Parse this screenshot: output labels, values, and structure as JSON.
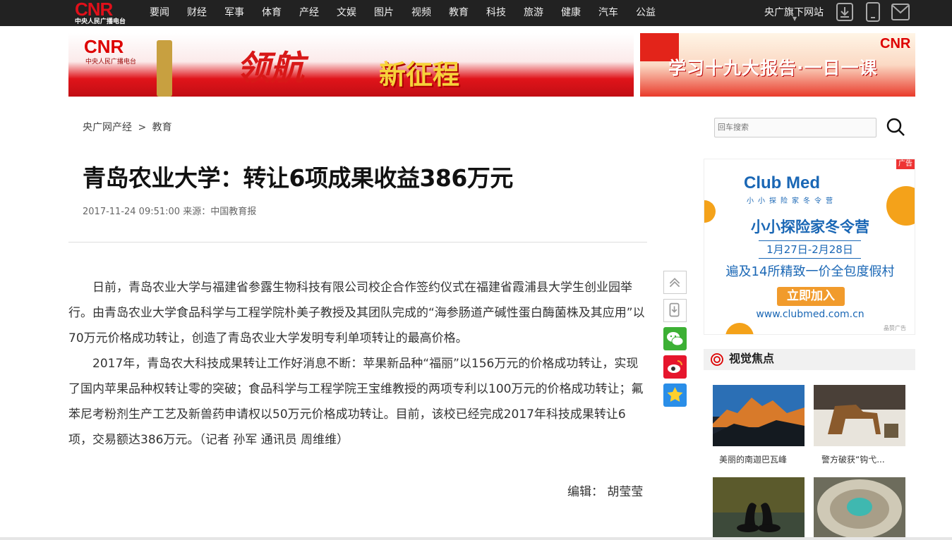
{
  "topnav": {
    "logo_text": "CNR",
    "logo_sub": "中央人民广播电台",
    "items": [
      "要闻",
      "财经",
      "军事",
      "体育",
      "产经",
      "文娱",
      "图片",
      "视频",
      "教育",
      "科技",
      "旅游",
      "健康",
      "汽车",
      "公益"
    ],
    "sites_label": "央广旗下网站",
    "icons": [
      "download-icon",
      "mobile-icon",
      "mail-icon"
    ]
  },
  "banners": {
    "left": {
      "logo": "CNR",
      "logo_sub": "中央人民广播电台",
      "title": "领航",
      "subtitle": "新征程"
    },
    "right": {
      "title": "学习十九大报告·一日一课",
      "logo": "CNR"
    }
  },
  "breadcrumb": {
    "parent": "央广网产经",
    "separator": ">",
    "current": "教育"
  },
  "search": {
    "placeholder": "回车搜索"
  },
  "article": {
    "title": "青岛农业大学：转让6项成果收益386万元",
    "datetime": "2017-11-24 09:51:00",
    "source": "来源：中国教育报",
    "paragraphs": [
      "日前，青岛农业大学与福建省参露生物科技有限公司校企合作签约仪式在福建省霞浦县大学生创业园举行。由青岛农业大学食品科学与工程学院朴美子教授及其团队完成的“海参肠道产碱性蛋白酶菌株及其应用”以70万元价格成功转让，创造了青岛农业大学发明专利单项转让的最高价格。",
      "2017年，青岛农大科技成果转让工作好消息不断：苹果新品种“福丽”以156万元的价格成功转让，实现了国内苹果品种权转让零的突破；食品科学与工程学院王宝维教授的两项专利以100万元的价格成功转让；氟苯尼考粉剂生产工艺及新兽药申请权以50万元价格成功转让。目前，该校已经完成2017年科技成果转让6项，交易额达386万元。（记者 孙军 通讯员 周维维）"
    ],
    "editor": "编辑： 胡莹莹"
  },
  "share": [
    "back-to-top-icon",
    "download-icon",
    "wechat-icon",
    "weibo-icon",
    "qzone-icon"
  ],
  "ad": {
    "tag": "广告",
    "brand": "Club Med",
    "brand_sub": "小小探险家冬令营",
    "headline": "小小探险家冬令营",
    "dates": "1月27日-2月28日",
    "offer": "遍及14所精致一价全包度假村",
    "cta": "立即加入",
    "url": "www.clubmed.com.cn",
    "footer": "晶赞广告"
  },
  "focus": {
    "heading": "视觉焦点",
    "items": [
      {
        "caption": "美丽的南迦巴瓦峰"
      },
      {
        "caption": "警方破获“钩弋..."
      },
      {
        "caption": ""
      },
      {
        "caption": ""
      }
    ]
  },
  "colors": {
    "nav_bg": "#222222",
    "accent_red": "#e0101a",
    "ad_blue": "#1a67b5",
    "ad_orange": "#f19b2c"
  }
}
